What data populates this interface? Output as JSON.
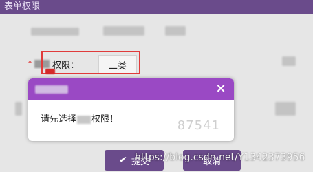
{
  "background_window": {
    "title": "表单权限",
    "form": {
      "required_mark": "*",
      "field_label": "权限：",
      "selected_value": "二类"
    },
    "buttons": {
      "confirm": "提交",
      "cancel": "取消"
    }
  },
  "modal": {
    "close_icon": "×",
    "message_prefix": "请先选择",
    "message_suffix": "权限！",
    "faint_watermark": "87541"
  },
  "watermark_text": "https://blog.csdn.net/Y1342373956",
  "colors": {
    "titlebar_purple": "#6a4b8b",
    "modal_header_purple": "#9a49c4",
    "highlight_red": "#e03b3b"
  }
}
